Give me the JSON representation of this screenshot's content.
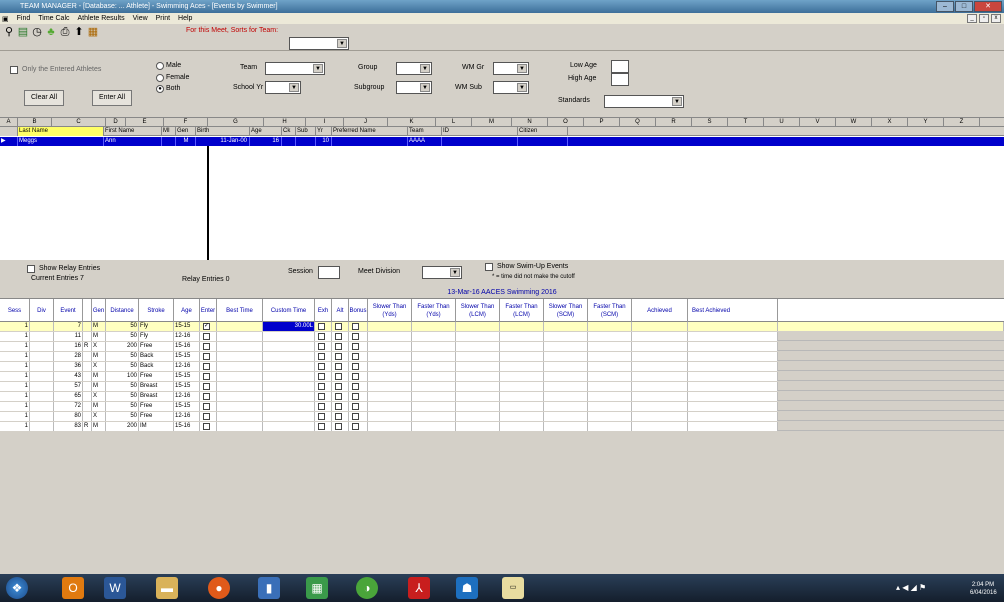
{
  "window": {
    "title": "TEAM MANAGER - [Database: ... Athlete] - Swimming Aces - [Events by Swimmer]"
  },
  "menu": [
    "Find",
    "Time Calc",
    "Athlete Results",
    "View",
    "Print",
    "Help"
  ],
  "toolbar": {
    "hint": "For this Meet, Sorts for Team:"
  },
  "filters": {
    "only_entered_label": "Only the Entered Athletes",
    "gender": [
      "Male",
      "Female",
      "Both"
    ],
    "gender_selected": "Both",
    "team_label": "Team",
    "school_yr_label": "School Yr",
    "group_label": "Group",
    "subgroup_label": "Subgroup",
    "wm_gr_label": "WM Gr",
    "wm_sub_label": "WM Sub",
    "low_age_label": "Low Age",
    "high_age_label": "High Age",
    "standards_label": "Standards",
    "clear_all": "Clear All",
    "enter_all": "Enter All"
  },
  "column_letters": [
    "A",
    "B",
    "C",
    "D",
    "E",
    "F",
    "G",
    "H",
    "I",
    "J",
    "K",
    "L",
    "M",
    "N",
    "O",
    "P",
    "Q",
    "R",
    "S",
    "T",
    "U",
    "V",
    "W",
    "X",
    "Y",
    "Z"
  ],
  "athlete_grid": {
    "headers": [
      "Last Name",
      "First Name",
      "MI",
      "Gen",
      "Birth",
      "Age",
      "Ck",
      "Sub",
      "Yr",
      "Preferred Name",
      "Team",
      "ID",
      "Citizen"
    ],
    "rows": [
      {
        "last": "Meggs",
        "first": "Ann",
        "mi": "",
        "gen": "M",
        "birth": "11-Jan-00",
        "age": "16",
        "ck": "",
        "sub": "",
        "yr": "10",
        "pref": "",
        "team": "AAAA",
        "id": "",
        "citizen": ""
      }
    ]
  },
  "relay": {
    "show_relay_label": "Show Relay Entries",
    "current_entries_label": "Current Entries",
    "current_entries_value": "7",
    "relay_entries_label": "Relay Entries",
    "relay_entries_value": "0",
    "session_label": "Session",
    "meet_division_label": "Meet Division",
    "show_swim_up_label": "Show Swim-Up Events",
    "swim_up_note": "* = time did not make the cutoff"
  },
  "meet_header": "13-Mar-16 AACES Swimming 2016",
  "event_headers": [
    "Sess",
    "Div",
    "Event",
    "",
    "Gen",
    "Distance",
    "Stroke",
    "Age",
    "Enter",
    "Best Time",
    "Custom Time",
    "Exh",
    "Alt",
    "Bonus",
    "Slower Than (Yds)",
    "Faster Than (Yds)",
    "Slower Than (LCM)",
    "Faster Than (LCM)",
    "Slower Than (SCM)",
    "Faster Than (SCM)",
    "Achieved",
    "Best Achieved"
  ],
  "events": [
    {
      "sess": "1",
      "event": "7",
      "r": "",
      "gen": "M",
      "dist": "50",
      "stroke": "Fly",
      "age": "15-15",
      "enter": true,
      "custom": "30.00L",
      "hl": true
    },
    {
      "sess": "1",
      "event": "11",
      "r": "",
      "gen": "M",
      "dist": "50",
      "stroke": "Fly",
      "age": "12-16",
      "enter": false,
      "custom": ""
    },
    {
      "sess": "1",
      "event": "16",
      "r": "R",
      "gen": "X",
      "dist": "200",
      "stroke": "Free",
      "age": "15-16",
      "enter": false,
      "custom": ""
    },
    {
      "sess": "1",
      "event": "28",
      "r": "",
      "gen": "M",
      "dist": "50",
      "stroke": "Back",
      "age": "15-15",
      "enter": false,
      "custom": ""
    },
    {
      "sess": "1",
      "event": "36",
      "r": "",
      "gen": "X",
      "dist": "50",
      "stroke": "Back",
      "age": "12-16",
      "enter": false,
      "custom": ""
    },
    {
      "sess": "1",
      "event": "43",
      "r": "",
      "gen": "M",
      "dist": "100",
      "stroke": "Free",
      "age": "15-15",
      "enter": false,
      "custom": ""
    },
    {
      "sess": "1",
      "event": "57",
      "r": "",
      "gen": "M",
      "dist": "50",
      "stroke": "Breast",
      "age": "15-15",
      "enter": false,
      "custom": ""
    },
    {
      "sess": "1",
      "event": "65",
      "r": "",
      "gen": "X",
      "dist": "50",
      "stroke": "Breast",
      "age": "12-16",
      "enter": false,
      "custom": ""
    },
    {
      "sess": "1",
      "event": "72",
      "r": "",
      "gen": "M",
      "dist": "50",
      "stroke": "Free",
      "age": "15-15",
      "enter": false,
      "custom": ""
    },
    {
      "sess": "1",
      "event": "80",
      "r": "",
      "gen": "X",
      "dist": "50",
      "stroke": "Free",
      "age": "12-16",
      "enter": false,
      "custom": ""
    },
    {
      "sess": "1",
      "event": "83",
      "r": "R",
      "gen": "M",
      "dist": "200",
      "stroke": "IM",
      "age": "15-16",
      "enter": false,
      "custom": ""
    }
  ],
  "taskbar": {
    "time": "2:04 PM",
    "date": "6/04/2016"
  }
}
